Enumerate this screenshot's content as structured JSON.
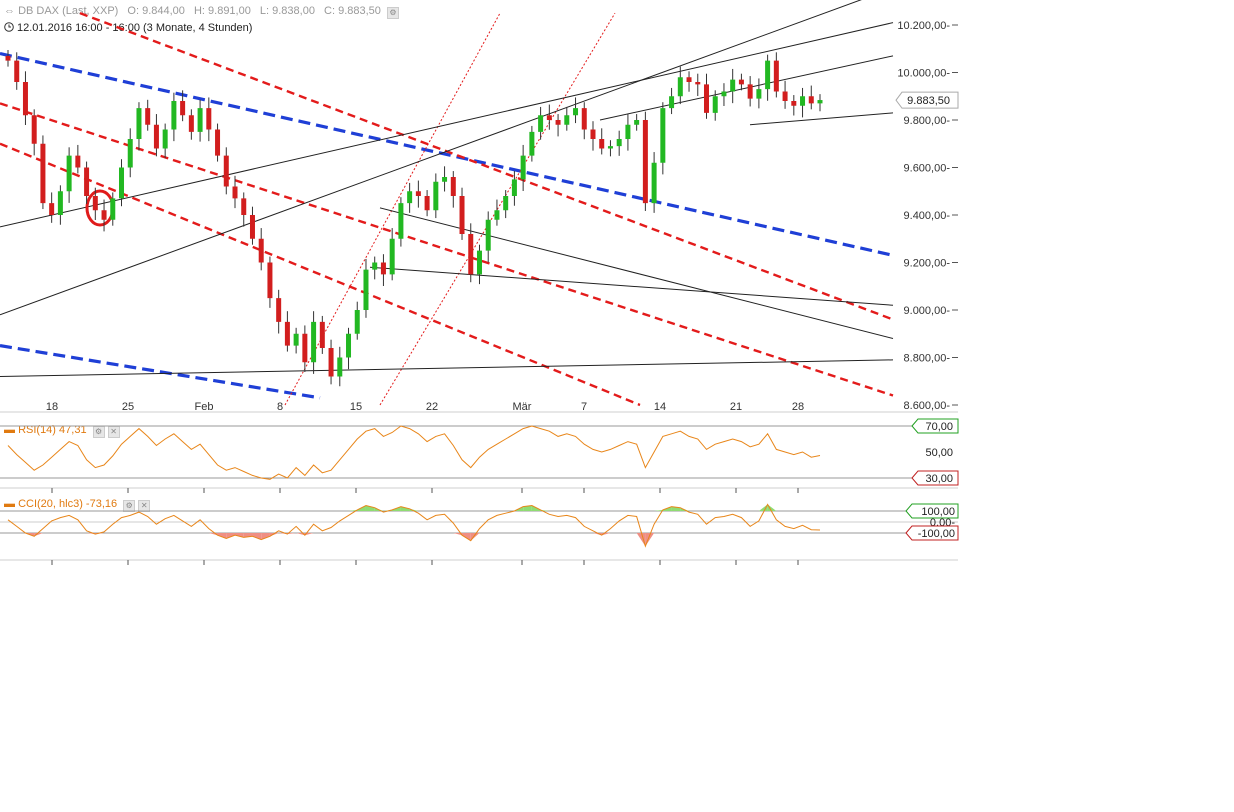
{
  "header": {
    "instrument": "DB DAX",
    "source": "(Last, XXP)",
    "ohlc": [
      "O: 9.844,00",
      "H: 9.891,00",
      "L: 9.838,00",
      "C: 9.883,50"
    ],
    "subtitle": "12.01.2016 16:00 - 16:00 (3 Monate, 4 Stunden)"
  },
  "chart_data": [
    {
      "type": "candlestick",
      "title": "DB DAX (Last, XXP)",
      "xlabel": "",
      "ylabel": "",
      "x_tick_labels": [
        "18",
        "25",
        "Feb",
        "8",
        "15",
        "22",
        "Mär",
        "7",
        "14",
        "21",
        "28"
      ],
      "y_tick_labels": [
        "10.200,00",
        "10.000,00",
        "9.800,00",
        "9.600,00",
        "9.400,00",
        "9.200,00",
        "9.000,00",
        "8.800,00",
        "8.600,00"
      ],
      "ylim": [
        8600,
        10250
      ],
      "last_price_label": "9.883,50",
      "last_price": 9883.5,
      "grid": false,
      "series": [
        {
          "name": "DB DAX",
          "values": [
            10050,
            9960,
            9820,
            9700,
            9450,
            9400,
            9500,
            9650,
            9600,
            9480,
            9420,
            9380,
            9470,
            9600,
            9720,
            9850,
            9780,
            9680,
            9760,
            9880,
            9820,
            9750,
            9850,
            9760,
            9650,
            9520,
            9470,
            9400,
            9300,
            9200,
            9050,
            8950,
            8850,
            8900,
            8780,
            8950,
            8840,
            8720,
            8800,
            8900,
            9000,
            9170,
            9200,
            9150,
            9300,
            9450,
            9500,
            9480,
            9420,
            9540,
            9560,
            9480,
            9320,
            9150,
            9250,
            9380,
            9420,
            9480,
            9550,
            9650,
            9750,
            9820,
            9800,
            9780,
            9820,
            9850,
            9760,
            9720,
            9680,
            9690,
            9720,
            9780,
            9800,
            9450,
            9620,
            9850,
            9900,
            9980,
            9960,
            9950,
            9830,
            9900,
            9920,
            9970,
            9950,
            9890,
            9930,
            10050,
            9920,
            9880,
            9860,
            9900,
            9870,
            9884
          ]
        }
      ]
    },
    {
      "type": "line",
      "title": "RSI(14)",
      "value_label": "47,31",
      "levels": [
        "70,00",
        "50,00",
        "30,00"
      ],
      "ylim": [
        25,
        75
      ],
      "series": [
        {
          "name": "RSI(14)",
          "values": [
            55,
            48,
            42,
            36,
            40,
            46,
            52,
            58,
            55,
            44,
            38,
            40,
            47,
            56,
            62,
            68,
            62,
            55,
            60,
            64,
            58,
            52,
            56,
            48,
            40,
            36,
            38,
            35,
            32,
            30,
            29,
            33,
            30,
            38,
            32,
            40,
            34,
            36,
            44,
            52,
            60,
            66,
            68,
            62,
            65,
            70,
            68,
            64,
            58,
            62,
            64,
            55,
            44,
            38,
            46,
            52,
            56,
            60,
            64,
            68,
            70,
            68,
            66,
            62,
            64,
            62,
            56,
            52,
            50,
            52,
            55,
            58,
            56,
            38,
            50,
            62,
            64,
            66,
            62,
            60,
            52,
            56,
            58,
            60,
            58,
            54,
            56,
            64,
            52,
            50,
            48,
            50,
            46,
            47.31
          ]
        }
      ]
    },
    {
      "type": "line",
      "title": "CCI(20, hlc3)",
      "value_label": "-73,16",
      "levels": [
        "100,00",
        "0,00",
        "-100,00"
      ],
      "ylim": [
        -250,
        250
      ],
      "series": [
        {
          "name": "CCI(20, hlc3)",
          "values": [
            20,
            -40,
            -100,
            -130,
            -60,
            10,
            40,
            60,
            20,
            -80,
            -110,
            -90,
            -20,
            40,
            60,
            90,
            50,
            -20,
            30,
            60,
            10,
            -40,
            20,
            -60,
            -120,
            -150,
            -120,
            -140,
            -130,
            -160,
            -130,
            -80,
            -110,
            -40,
            -120,
            -20,
            -80,
            -50,
            10,
            60,
            110,
            150,
            130,
            90,
            110,
            140,
            120,
            80,
            20,
            60,
            70,
            -10,
            -120,
            -170,
            -60,
            20,
            60,
            80,
            100,
            140,
            150,
            110,
            70,
            50,
            60,
            40,
            -40,
            -80,
            -120,
            -60,
            10,
            60,
            50,
            -220,
            -20,
            110,
            140,
            130,
            90,
            70,
            -20,
            40,
            50,
            70,
            40,
            -40,
            10,
            160,
            20,
            -40,
            -60,
            -30,
            -70,
            -73.16
          ]
        }
      ]
    }
  ],
  "colors": {
    "up": "#22b822",
    "down": "#d21e1e",
    "trend_red": "#e31b1b",
    "trend_blue": "#1f3fd6",
    "indicator": "#e8861a",
    "cci_positive_fill": "#8fdc72",
    "cci_negative_fill": "#ef8f84"
  },
  "icons": [
    "settings-icon",
    "close-icon",
    "clock-icon",
    "collapse-icon"
  ]
}
